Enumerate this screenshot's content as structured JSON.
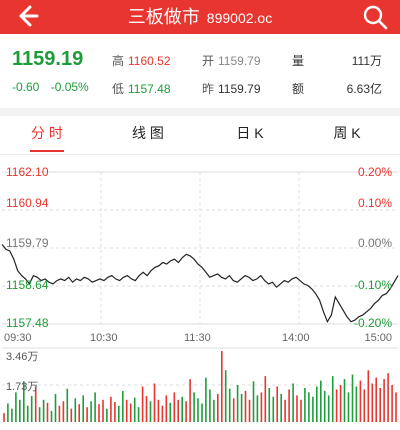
{
  "header": {
    "title": "三板做市",
    "code": "899002.oc",
    "back_icon": "arrow-left-icon",
    "search_icon": "search-icon",
    "bg": "#e8352f"
  },
  "quote": {
    "price": "1159.19",
    "change": "-0.60",
    "change_pct": "-0.05%",
    "high_label": "高",
    "high": "1160.52",
    "low_label": "低",
    "low": "1157.48",
    "open_label": "开",
    "open": "1159.79",
    "prev_label": "昨",
    "prev": "1159.79",
    "volume_label": "量",
    "volume": "111万",
    "amount_label": "额",
    "amount": "6.63亿"
  },
  "tabs": [
    {
      "label": "分 时",
      "active": true
    },
    {
      "label": "线 图",
      "active": false
    },
    {
      "label": "日 K",
      "active": false
    },
    {
      "label": "周 K",
      "active": false
    }
  ],
  "chart_data": {
    "type": "line",
    "price_ticks": [
      "1162.10",
      "1160.94",
      "1159.79",
      "1158.64",
      "1157.48"
    ],
    "pct_ticks": [
      "0.20%",
      "0.10%",
      "0.00%",
      "-0.10%",
      "-0.20%"
    ],
    "time_ticks": [
      "09:30",
      "10:30",
      "11:30",
      "14:00",
      "15:00"
    ],
    "volume_ticks": [
      "3.46万",
      "1.73万"
    ],
    "ylim": [
      1157.48,
      1162.1
    ],
    "prev_close": 1159.79,
    "price_series": [
      1159.9,
      1159.75,
      1159.7,
      1159.45,
      1159.1,
      1158.95,
      1158.85,
      1158.7,
      1158.95,
      1158.9,
      1158.8,
      1158.85,
      1158.75,
      1158.7,
      1158.8,
      1158.85,
      1158.8,
      1158.9,
      1158.75,
      1158.85,
      1158.8,
      1158.9,
      1158.85,
      1158.75,
      1158.8,
      1158.85,
      1158.8,
      1158.9,
      1158.95,
      1158.85,
      1158.8,
      1158.9,
      1158.95,
      1158.85,
      1158.8,
      1158.95,
      1159.05,
      1158.95,
      1159.1,
      1159.2,
      1159.25,
      1159.35,
      1159.3,
      1159.4,
      1159.45,
      1159.35,
      1159.5,
      1159.6,
      1159.55,
      1159.45,
      1159.3,
      1159.2,
      1159.05,
      1158.9,
      1158.95,
      1159.0,
      1158.9,
      1158.85,
      1158.95,
      1158.8,
      1158.75,
      1158.85,
      1158.95,
      1158.9,
      1158.8,
      1158.85,
      1158.95,
      1158.8,
      1158.7,
      1158.75,
      1158.6,
      1158.7,
      1158.8,
      1158.75,
      1158.85,
      1158.9,
      1158.8,
      1158.7,
      1158.65,
      1158.55,
      1158.4,
      1158.2,
      1157.85,
      1157.55,
      1157.75,
      1158.3,
      1158.1,
      1157.9,
      1157.7,
      1157.55,
      1157.6,
      1157.7,
      1157.75,
      1157.85,
      1157.95,
      1158.1,
      1158.2,
      1158.35,
      1158.4,
      1158.55,
      1158.75,
      1158.95
    ],
    "volume_series": [
      0.12,
      0.25,
      0.18,
      0.4,
      0.3,
      0.55,
      0.22,
      0.35,
      0.48,
      0.2,
      0.3,
      0.26,
      0.15,
      0.38,
      0.22,
      0.28,
      0.45,
      0.18,
      0.32,
      0.24,
      0.36,
      0.2,
      0.28,
      0.4,
      0.24,
      0.3,
      0.18,
      0.34,
      0.27,
      0.22,
      0.42,
      0.3,
      0.25,
      0.33,
      0.2,
      0.48,
      0.35,
      0.28,
      0.52,
      0.3,
      0.22,
      0.36,
      0.26,
      0.4,
      0.3,
      0.34,
      0.28,
      0.58,
      0.4,
      0.32,
      0.25,
      0.6,
      0.44,
      0.3,
      0.38,
      0.96,
      0.7,
      0.45,
      0.32,
      0.5,
      0.38,
      0.42,
      0.3,
      0.55,
      0.36,
      0.4,
      0.62,
      0.46,
      0.34,
      0.48,
      0.38,
      0.3,
      0.44,
      0.52,
      0.36,
      0.3,
      0.46,
      0.4,
      0.34,
      0.48,
      0.56,
      0.42,
      0.36,
      0.62,
      0.44,
      0.5,
      0.58,
      0.4,
      0.64,
      0.48,
      0.56,
      0.44,
      0.7,
      0.52,
      0.6,
      0.46,
      0.58,
      0.66,
      0.5,
      0.4
    ],
    "line_color": "#222222",
    "up_color": "#e8352f",
    "down_color": "#1e9c3a",
    "grid_color": "#dddddd"
  }
}
